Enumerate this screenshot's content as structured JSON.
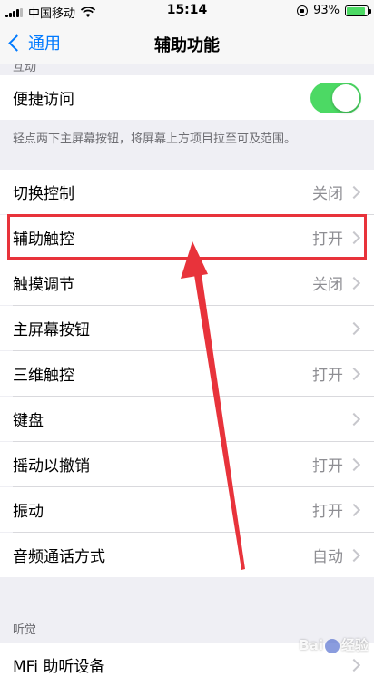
{
  "status_bar": {
    "carrier": "中国移动",
    "time": "15:14",
    "battery_percent": "93%",
    "battery_level": 0.93,
    "icons": [
      "signal-icon",
      "wifi-icon",
      "rotation-lock-icon",
      "battery-icon"
    ]
  },
  "nav": {
    "back_label": "通用",
    "title": "辅助功能"
  },
  "section_cut_label": "互动",
  "shortcut": {
    "label": "便捷访问",
    "toggle_on": true,
    "footnote": "轻点两下主屏幕按钮，将屏幕上方项目拉至可及范围。"
  },
  "items": [
    {
      "label": "切换控制",
      "value": "关闭"
    },
    {
      "label": "辅助触控",
      "value": "打开"
    },
    {
      "label": "触摸调节",
      "value": "关闭"
    },
    {
      "label": "主屏幕按钮",
      "value": ""
    },
    {
      "label": "三维触控",
      "value": "打开"
    },
    {
      "label": "键盘",
      "value": ""
    },
    {
      "label": "摇动以撤销",
      "value": "打开"
    },
    {
      "label": "振动",
      "value": "打开"
    },
    {
      "label": "音频通话方式",
      "value": "自动"
    }
  ],
  "hearing": {
    "header": "听觉",
    "first_item": "MFi 助听设备"
  },
  "watermark": {
    "text_left": "Bai",
    "text_right": "经验"
  },
  "colors": {
    "accent": "#007aff",
    "toggle_on": "#4cd964",
    "annotation_red": "#e8333b",
    "background": "#efeff4"
  }
}
